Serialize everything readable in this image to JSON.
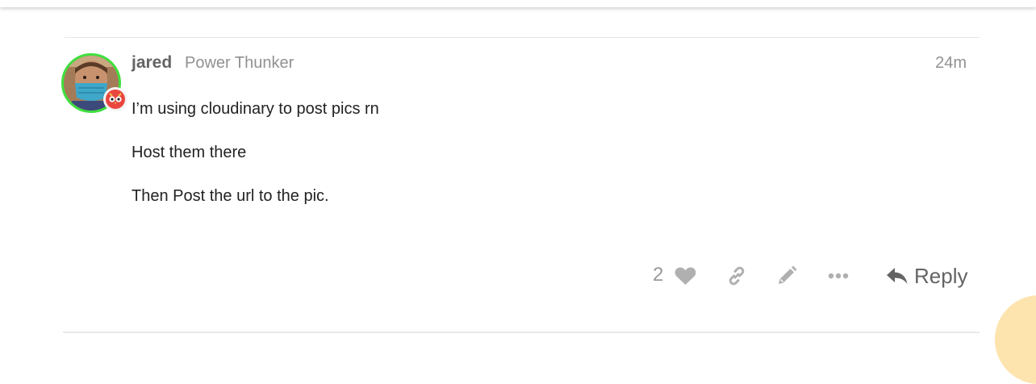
{
  "post": {
    "username": "jared",
    "user_title": "Power Thunker",
    "timestamp": "24m",
    "paragraphs": [
      "I’m using cloudinary to post pics rn",
      "Host them there",
      "Then Post the url to the pic."
    ]
  },
  "actions": {
    "like_count": "2",
    "reply_label": "Reply",
    "icons": [
      "heart-icon",
      "link-icon",
      "pencil-icon",
      "more-icon",
      "reply-icon"
    ]
  },
  "colors": {
    "avatar_ring": "#3ee03e",
    "icon_gray": "#b0b0b0",
    "flair_red": "#e9463f"
  }
}
